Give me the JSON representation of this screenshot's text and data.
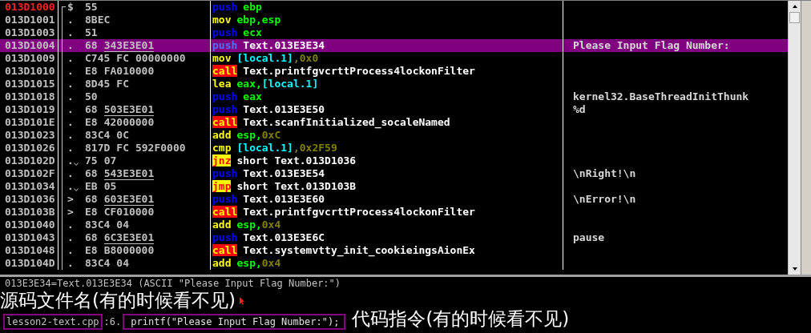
{
  "disassembly": {
    "rows": [
      {
        "address": "013D1000",
        "marked": true,
        "selected": false,
        "marker": "$",
        "jump_down": false,
        "bytes": [
          {
            "text": "55",
            "underlined": false
          }
        ],
        "mnemonic": {
          "text": "push",
          "kind": "stack"
        },
        "operands": [
          {
            "text": "ebp",
            "kind": "reg"
          }
        ]
      },
      {
        "address": "013D1001",
        "marked": false,
        "selected": false,
        "marker": ".",
        "jump_down": false,
        "bytes": [
          {
            "text": "8BEC",
            "underlined": false
          }
        ],
        "mnemonic": {
          "text": "mov",
          "kind": "plain"
        },
        "operands": [
          {
            "text": "ebp,esp",
            "kind": "reg"
          }
        ]
      },
      {
        "address": "013D1003",
        "marked": false,
        "selected": false,
        "marker": ".",
        "jump_down": false,
        "bytes": [
          {
            "text": "51",
            "underlined": false
          }
        ],
        "mnemonic": {
          "text": "push",
          "kind": "stack"
        },
        "operands": [
          {
            "text": "ecx",
            "kind": "reg"
          }
        ]
      },
      {
        "address": "013D1004",
        "marked": false,
        "selected": true,
        "marker": ".",
        "jump_down": false,
        "bytes": [
          {
            "text": "68",
            "underlined": false
          },
          {
            "text": "343E3E01",
            "underlined": true
          }
        ],
        "mnemonic": {
          "text": "push",
          "kind": "stack"
        },
        "operands": [
          {
            "text": "Text.013E3E34",
            "kind": "sym"
          }
        ],
        "comment": "Please Input Flag Number:"
      },
      {
        "address": "013D1009",
        "marked": false,
        "selected": false,
        "marker": ".",
        "jump_down": false,
        "bytes": [
          {
            "text": "C745",
            "underlined": false
          },
          {
            "text": "FC",
            "underlined": false
          },
          {
            "text": "00000000",
            "underlined": false
          }
        ],
        "mnemonic": {
          "text": "mov",
          "kind": "plain"
        },
        "operands": [
          {
            "text": "[local.1]",
            "kind": "mem"
          },
          {
            "text": ",",
            "kind": "const"
          },
          {
            "text": "0x0",
            "kind": "const"
          }
        ]
      },
      {
        "address": "013D1010",
        "marked": false,
        "selected": false,
        "marker": ".",
        "jump_down": false,
        "bytes": [
          {
            "text": "E8",
            "underlined": false
          },
          {
            "text": "FA010000",
            "underlined": false
          }
        ],
        "mnemonic": {
          "text": "call",
          "kind": "call"
        },
        "operands": [
          {
            "text": "Text.printfgvcrttProcess4lockonFilter",
            "kind": "sym"
          }
        ]
      },
      {
        "address": "013D1015",
        "marked": false,
        "selected": false,
        "marker": ".",
        "jump_down": false,
        "bytes": [
          {
            "text": "8D45",
            "underlined": false
          },
          {
            "text": "FC",
            "underlined": false
          }
        ],
        "mnemonic": {
          "text": "lea",
          "kind": "plain"
        },
        "operands": [
          {
            "text": "eax,",
            "kind": "reg"
          },
          {
            "text": "[local.1]",
            "kind": "mem"
          }
        ]
      },
      {
        "address": "013D1018",
        "marked": false,
        "selected": false,
        "marker": ".",
        "jump_down": false,
        "bytes": [
          {
            "text": "50",
            "underlined": false
          }
        ],
        "mnemonic": {
          "text": "push",
          "kind": "stack"
        },
        "operands": [
          {
            "text": "eax",
            "kind": "reg"
          }
        ],
        "comment": "kernel32.BaseThreadInitThunk"
      },
      {
        "address": "013D1019",
        "marked": false,
        "selected": false,
        "marker": ".",
        "jump_down": false,
        "bytes": [
          {
            "text": "68",
            "underlined": false
          },
          {
            "text": "503E3E01",
            "underlined": true
          }
        ],
        "mnemonic": {
          "text": "push",
          "kind": "stack"
        },
        "operands": [
          {
            "text": "Text.013E3E50",
            "kind": "sym"
          }
        ],
        "comment": "%d"
      },
      {
        "address": "013D101E",
        "marked": false,
        "selected": false,
        "marker": ".",
        "jump_down": false,
        "bytes": [
          {
            "text": "E8",
            "underlined": false
          },
          {
            "text": "42000000",
            "underlined": false
          }
        ],
        "mnemonic": {
          "text": "call",
          "kind": "call"
        },
        "operands": [
          {
            "text": "Text.scanfInitialized_socaleNamed",
            "kind": "sym"
          }
        ]
      },
      {
        "address": "013D1023",
        "marked": false,
        "selected": false,
        "marker": ".",
        "jump_down": false,
        "bytes": [
          {
            "text": "83C4",
            "underlined": false
          },
          {
            "text": "0C",
            "underlined": false
          }
        ],
        "mnemonic": {
          "text": "add",
          "kind": "plain"
        },
        "operands": [
          {
            "text": "esp,",
            "kind": "reg"
          },
          {
            "text": "0xC",
            "kind": "const"
          }
        ]
      },
      {
        "address": "013D1026",
        "marked": false,
        "selected": false,
        "marker": ".",
        "jump_down": false,
        "bytes": [
          {
            "text": "817D",
            "underlined": false
          },
          {
            "text": "FC",
            "underlined": false
          },
          {
            "text": "592F0000",
            "underlined": false
          }
        ],
        "mnemonic": {
          "text": "cmp",
          "kind": "plain"
        },
        "operands": [
          {
            "text": "[local.1]",
            "kind": "mem"
          },
          {
            "text": ",",
            "kind": "const"
          },
          {
            "text": "0x2F59",
            "kind": "const"
          }
        ]
      },
      {
        "address": "013D102D",
        "marked": false,
        "selected": false,
        "marker": ".",
        "jump_down": true,
        "bytes": [
          {
            "text": "75",
            "underlined": false
          },
          {
            "text": "07",
            "underlined": false
          }
        ],
        "mnemonic": {
          "text": "jnz",
          "kind": "jump"
        },
        "operands": [
          {
            "text": "short Text.013D1036",
            "kind": "sym"
          }
        ]
      },
      {
        "address": "013D102F",
        "marked": false,
        "selected": false,
        "marker": ".",
        "jump_down": false,
        "bytes": [
          {
            "text": "68",
            "underlined": false
          },
          {
            "text": "543E3E01",
            "underlined": true
          }
        ],
        "mnemonic": {
          "text": "push",
          "kind": "stack"
        },
        "operands": [
          {
            "text": "Text.013E3E54",
            "kind": "sym"
          }
        ],
        "comment": "\\nRight!\\n"
      },
      {
        "address": "013D1034",
        "marked": false,
        "selected": false,
        "marker": ".",
        "jump_down": true,
        "bytes": [
          {
            "text": "EB",
            "underlined": false
          },
          {
            "text": "05",
            "underlined": false
          }
        ],
        "mnemonic": {
          "text": "jmp",
          "kind": "jump"
        },
        "operands": [
          {
            "text": "short Text.013D103B",
            "kind": "sym"
          }
        ]
      },
      {
        "address": "013D1036",
        "marked": false,
        "selected": false,
        "marker": ">",
        "jump_down": false,
        "bytes": [
          {
            "text": "68",
            "underlined": false
          },
          {
            "text": "603E3E01",
            "underlined": true
          }
        ],
        "mnemonic": {
          "text": "push",
          "kind": "stack"
        },
        "operands": [
          {
            "text": "Text.013E3E60",
            "kind": "sym"
          }
        ],
        "comment": "\\nError!\\n"
      },
      {
        "address": "013D103B",
        "marked": false,
        "selected": false,
        "marker": ">",
        "jump_down": false,
        "bytes": [
          {
            "text": "E8",
            "underlined": false
          },
          {
            "text": "CF010000",
            "underlined": false
          }
        ],
        "mnemonic": {
          "text": "call",
          "kind": "call"
        },
        "operands": [
          {
            "text": "Text.printfgvcrttProcess4lockonFilter",
            "kind": "sym"
          }
        ]
      },
      {
        "address": "013D1040",
        "marked": false,
        "selected": false,
        "marker": ".",
        "jump_down": false,
        "bytes": [
          {
            "text": "83C4",
            "underlined": false
          },
          {
            "text": "04",
            "underlined": false
          }
        ],
        "mnemonic": {
          "text": "add",
          "kind": "plain"
        },
        "operands": [
          {
            "text": "esp,",
            "kind": "reg"
          },
          {
            "text": "0x4",
            "kind": "const"
          }
        ]
      },
      {
        "address": "013D1043",
        "marked": false,
        "selected": false,
        "marker": ".",
        "jump_down": false,
        "bytes": [
          {
            "text": "68",
            "underlined": false
          },
          {
            "text": "6C3E3E01",
            "underlined": true
          }
        ],
        "mnemonic": {
          "text": "push",
          "kind": "stack"
        },
        "operands": [
          {
            "text": "Text.013E3E6C",
            "kind": "sym"
          }
        ],
        "comment": "pause"
      },
      {
        "address": "013D1048",
        "marked": false,
        "selected": false,
        "marker": ".",
        "jump_down": false,
        "bytes": [
          {
            "text": "E8",
            "underlined": false
          },
          {
            "text": "B8000000",
            "underlined": false
          }
        ],
        "mnemonic": {
          "text": "call",
          "kind": "call"
        },
        "operands": [
          {
            "text": "Text.systemvtty_init_cookieingsAionEx",
            "kind": "sym"
          }
        ]
      },
      {
        "address": "013D104D",
        "marked": false,
        "selected": false,
        "marker": ".",
        "jump_down": false,
        "bytes": [
          {
            "text": "83C4",
            "underlined": false
          },
          {
            "text": "04",
            "underlined": false
          }
        ],
        "mnemonic": {
          "text": "add",
          "kind": "plain"
        },
        "operands": [
          {
            "text": "esp,",
            "kind": "reg"
          },
          {
            "text": "0x4",
            "kind": "const"
          }
        ]
      }
    ]
  },
  "info_line": "013E3E34=Text.013E3E34 (ASCII \"Please Input Flag Number:\")",
  "annotations": [
    {
      "text": "源码文件名(有的时候看不见)"
    },
    {
      "text": "代码指令(有的时候看不见)"
    }
  ],
  "source_line": {
    "file": "lesson2-text.cpp",
    "line": ":6.",
    "code": "printf(\"Please Input Flag Number:\");"
  }
}
